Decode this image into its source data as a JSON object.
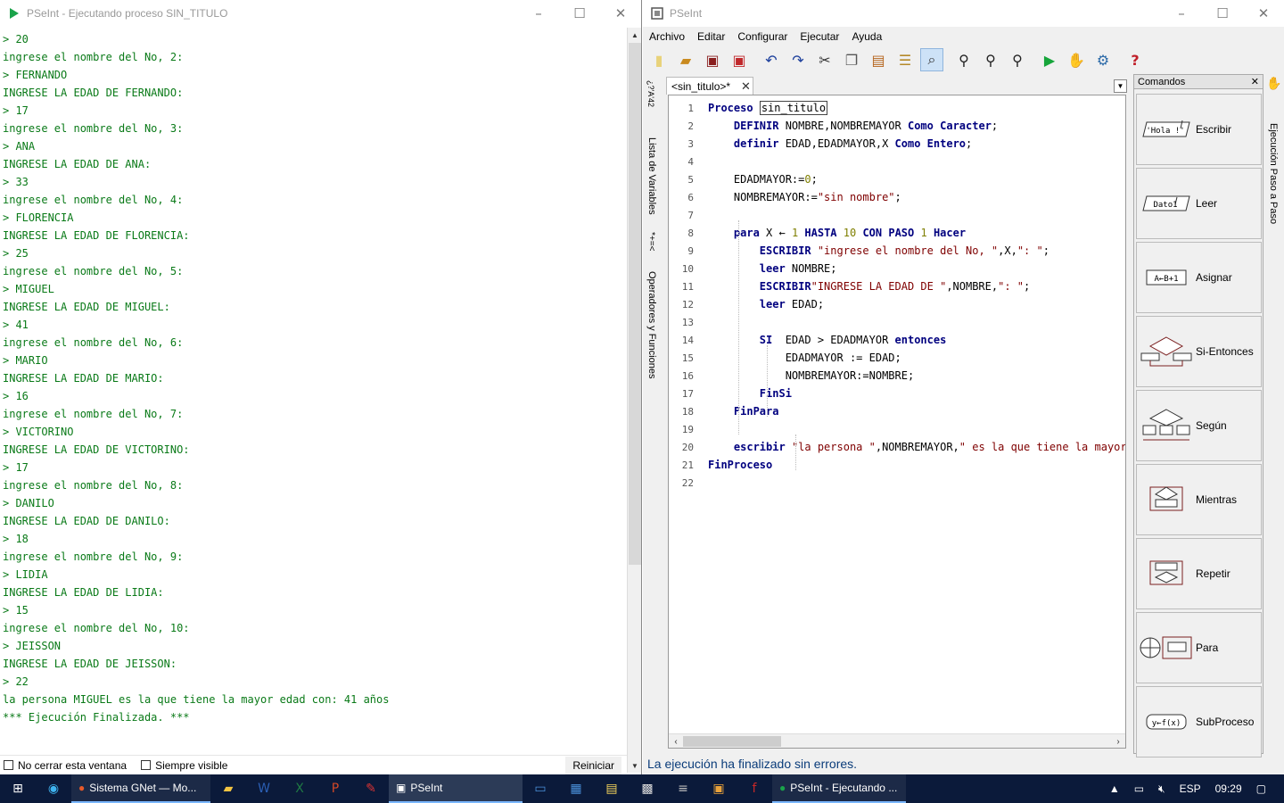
{
  "console": {
    "title": "PSeInt - Ejecutando proceso SIN_TITULO",
    "lines": [
      "> 20",
      "ingrese el nombre del No, 2:",
      "> FERNANDO",
      "INGRESE LA EDAD DE FERNANDO:",
      "> 17",
      "ingrese el nombre del No, 3:",
      "> ANA",
      "INGRESE LA EDAD DE ANA:",
      "> 33",
      "ingrese el nombre del No, 4:",
      "> FLORENCIA",
      "INGRESE LA EDAD DE FLORENCIA:",
      "> 25",
      "ingrese el nombre del No, 5:",
      "> MIGUEL",
      "INGRESE LA EDAD DE MIGUEL:",
      "> 41",
      "ingrese el nombre del No, 6:",
      "> MARIO",
      "INGRESE LA EDAD DE MARIO:",
      "> 16",
      "ingrese el nombre del No, 7:",
      "> VICTORINO",
      "INGRESE LA EDAD DE VICTORINO:",
      "> 17",
      "ingrese el nombre del No, 8:",
      "> DANILO",
      "INGRESE LA EDAD DE DANILO:",
      "> 18",
      "ingrese el nombre del No, 9:",
      "> LIDIA",
      "INGRESE LA EDAD DE LIDIA:",
      "> 15",
      "ingrese el nombre del No, 10:",
      "> JEISSON",
      "INGRESE LA EDAD DE JEISSON:",
      "> 22",
      "la persona MIGUEL es la que tiene la mayor edad con: 41 años",
      "*** Ejecución Finalizada. ***"
    ],
    "no_cerrar_label": "No cerrar esta ventana",
    "siempre_visible_label": "Siempre visible",
    "reiniciar_label": "Reiniciar",
    "text_color": "#0a7a18"
  },
  "pseint": {
    "title": "PSeInt",
    "menu": [
      "Archivo",
      "Editar",
      "Configurar",
      "Ejecutar",
      "Ayuda"
    ],
    "tab_label": "<sin_titulo>*",
    "left_labels": [
      "Lista de Variables",
      "Operadores y Funciones"
    ],
    "left_symbols": [
      "*+=<",
      "¿?'A'42"
    ],
    "right_label": "Ejecución Paso a Paso",
    "comandos_title": "Comandos",
    "commands": [
      {
        "label": "Escribir",
        "icon_text": "'Hola !'"
      },
      {
        "label": "Leer",
        "icon_text": "Dato1"
      },
      {
        "label": "Asignar",
        "icon_text": "A←B+1"
      },
      {
        "label": "Si-Entonces",
        "icon_text": ""
      },
      {
        "label": "Según",
        "icon_text": ""
      },
      {
        "label": "Mientras",
        "icon_text": ""
      },
      {
        "label": "Repetir",
        "icon_text": ""
      },
      {
        "label": "Para",
        "icon_text": ""
      },
      {
        "label": "SubProceso",
        "icon_text": "y←f(x)"
      }
    ],
    "status": "La ejecución ha finalizado sin errores.",
    "code_lines": [
      {
        "n": "1",
        "tokens": [
          [
            "kw",
            "Proceso"
          ],
          [
            "idn",
            " "
          ],
          [
            "box",
            "sin_titulo"
          ]
        ]
      },
      {
        "n": "2",
        "tokens": [
          [
            "idn",
            "    "
          ],
          [
            "kw",
            "DEFINIR"
          ],
          [
            "idn",
            " NOMBRE,NOMBREMAYOR "
          ],
          [
            "kw",
            "Como"
          ],
          [
            "idn",
            " "
          ],
          [
            "kw",
            "Caracter"
          ],
          [
            "idn",
            ";"
          ]
        ]
      },
      {
        "n": "3",
        "tokens": [
          [
            "idn",
            "    "
          ],
          [
            "kw",
            "definir"
          ],
          [
            "idn",
            " EDAD,EDADMAYOR,X "
          ],
          [
            "kw",
            "Como"
          ],
          [
            "idn",
            " "
          ],
          [
            "kw",
            "Entero"
          ],
          [
            "idn",
            ";"
          ]
        ]
      },
      {
        "n": "4",
        "tokens": []
      },
      {
        "n": "5",
        "tokens": [
          [
            "idn",
            "    EDADMAYOR:="
          ],
          [
            "num",
            "0"
          ],
          [
            "idn",
            ";"
          ]
        ]
      },
      {
        "n": "6",
        "tokens": [
          [
            "idn",
            "    NOMBREMAYOR:="
          ],
          [
            "str",
            "\"sin nombre\""
          ],
          [
            "idn",
            ";"
          ]
        ]
      },
      {
        "n": "7",
        "tokens": []
      },
      {
        "n": "8",
        "tokens": [
          [
            "idn",
            "    "
          ],
          [
            "kw",
            "para"
          ],
          [
            "idn",
            " X ← "
          ],
          [
            "num",
            "1"
          ],
          [
            "idn",
            " "
          ],
          [
            "kw",
            "HASTA"
          ],
          [
            "idn",
            " "
          ],
          [
            "num",
            "10"
          ],
          [
            "idn",
            " "
          ],
          [
            "kw",
            "CON PASO"
          ],
          [
            "idn",
            " "
          ],
          [
            "num",
            "1"
          ],
          [
            "idn",
            " "
          ],
          [
            "kw",
            "Hacer"
          ]
        ]
      },
      {
        "n": "9",
        "tokens": [
          [
            "idn",
            "        "
          ],
          [
            "kw",
            "ESCRIBIR"
          ],
          [
            "idn",
            " "
          ],
          [
            "str",
            "\"ingrese el nombre del No, \""
          ],
          [
            "idn",
            ",X,"
          ],
          [
            "str",
            "\": \""
          ],
          [
            "idn",
            ";"
          ]
        ]
      },
      {
        "n": "10",
        "tokens": [
          [
            "idn",
            "        "
          ],
          [
            "kw",
            "leer"
          ],
          [
            "idn",
            " NOMBRE;"
          ]
        ]
      },
      {
        "n": "11",
        "tokens": [
          [
            "idn",
            "        "
          ],
          [
            "kw",
            "ESCRIBIR"
          ],
          [
            "str",
            "\"INGRESE LA EDAD DE \""
          ],
          [
            "idn",
            ",NOMBRE,"
          ],
          [
            "str",
            "\": \""
          ],
          [
            "idn",
            ";"
          ]
        ]
      },
      {
        "n": "12",
        "tokens": [
          [
            "idn",
            "        "
          ],
          [
            "kw",
            "leer"
          ],
          [
            "idn",
            " EDAD;"
          ]
        ]
      },
      {
        "n": "13",
        "tokens": []
      },
      {
        "n": "14",
        "tokens": [
          [
            "idn",
            "        "
          ],
          [
            "kw",
            "SI"
          ],
          [
            "idn",
            "  EDAD > EDADMAYOR "
          ],
          [
            "kw",
            "entonces"
          ]
        ]
      },
      {
        "n": "15",
        "tokens": [
          [
            "idn",
            "            EDADMAYOR := EDAD;"
          ]
        ]
      },
      {
        "n": "16",
        "tokens": [
          [
            "idn",
            "            NOMBREMAYOR:=NOMBRE;"
          ]
        ]
      },
      {
        "n": "17",
        "tokens": [
          [
            "idn",
            "        "
          ],
          [
            "kw",
            "FinSi"
          ]
        ]
      },
      {
        "n": "18",
        "tokens": [
          [
            "idn",
            "    "
          ],
          [
            "kw",
            "FinPara"
          ]
        ]
      },
      {
        "n": "19",
        "tokens": []
      },
      {
        "n": "20",
        "tokens": [
          [
            "idn",
            "    "
          ],
          [
            "kw",
            "escribir"
          ],
          [
            "idn",
            " "
          ],
          [
            "str",
            "\"la persona \""
          ],
          [
            "idn",
            ",NOMBREMAYOR,"
          ],
          [
            "str",
            "\" es la que tiene la mayor"
          ]
        ]
      },
      {
        "n": "21",
        "tokens": [
          [
            "kw",
            "FinProceso"
          ]
        ]
      },
      {
        "n": "22",
        "tokens": []
      }
    ]
  },
  "taskbar": {
    "tasks": [
      {
        "label": "Sistema GNet — Mo...",
        "state": "open"
      },
      {
        "label": "PSeInt",
        "state": "active"
      },
      {
        "label": "PSeInt - Ejecutando ...",
        "state": "open"
      }
    ],
    "lang": "ESP",
    "time": "09:29"
  }
}
